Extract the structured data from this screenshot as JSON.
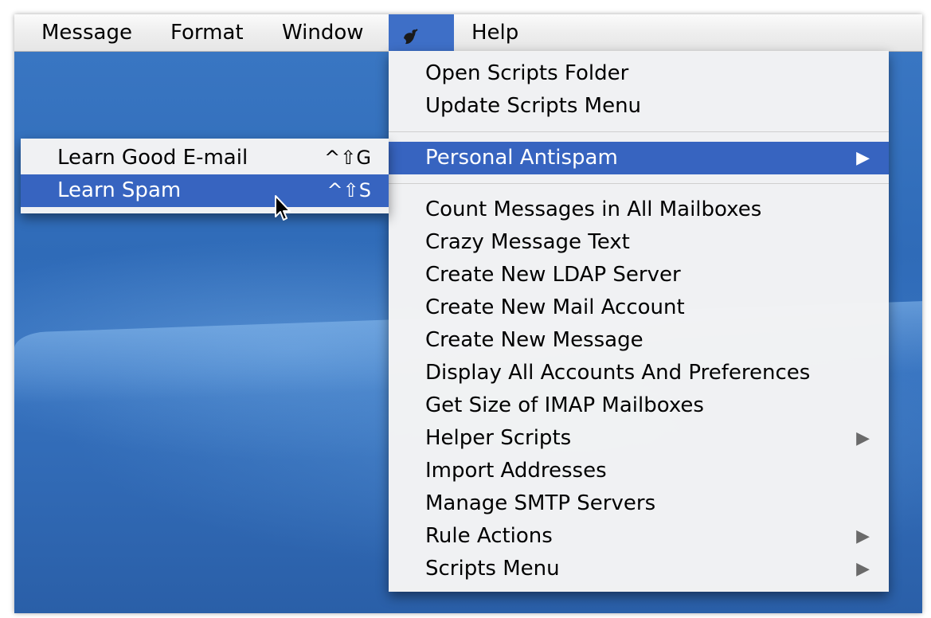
{
  "menubar": {
    "items": [
      {
        "label": "Message"
      },
      {
        "label": "Format"
      },
      {
        "label": "Window"
      },
      {
        "label": "Help"
      }
    ],
    "script_icon": "script-menu-icon"
  },
  "scripts_menu": {
    "items": [
      {
        "label": "Open Scripts Folder"
      },
      {
        "label": "Update Scripts Menu"
      },
      {
        "label": "Personal Antispam",
        "submenu_arrow": "▶"
      },
      {
        "label": "Count Messages in All Mailboxes"
      },
      {
        "label": "Crazy Message Text"
      },
      {
        "label": "Create New LDAP Server"
      },
      {
        "label": "Create New Mail Account"
      },
      {
        "label": "Create New Message"
      },
      {
        "label": "Display All Accounts And Preferences"
      },
      {
        "label": "Get Size of IMAP Mailboxes"
      },
      {
        "label": "Helper Scripts",
        "submenu_arrow": "▶"
      },
      {
        "label": "Import Addresses"
      },
      {
        "label": "Manage SMTP Servers"
      },
      {
        "label": "Rule Actions",
        "submenu_arrow": "▶"
      },
      {
        "label": "Scripts Menu",
        "submenu_arrow": "▶"
      }
    ]
  },
  "antispam_submenu": {
    "items": [
      {
        "label": "Learn Good E-mail",
        "shortcut": "^⇧G"
      },
      {
        "label": "Learn Spam",
        "shortcut": "^⇧S"
      }
    ]
  },
  "colors": {
    "highlight": "#3764c0",
    "desktop": "#3b78c4"
  }
}
